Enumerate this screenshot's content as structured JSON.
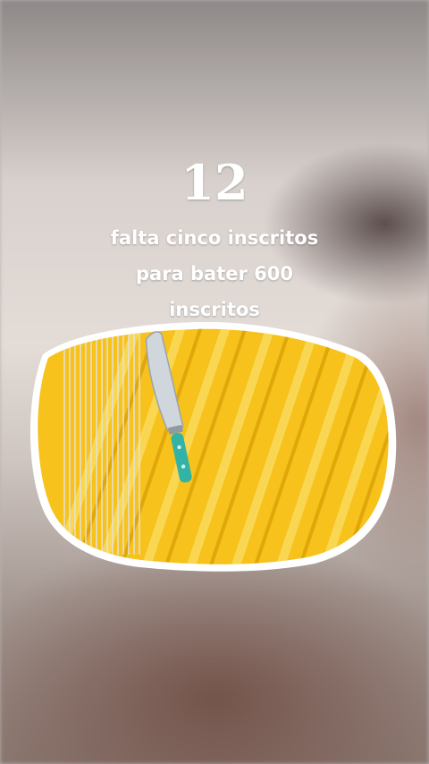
{
  "overlay": {
    "countdown": "12",
    "caption_lines": [
      "falta cinco inscritos",
      "para bater 600",
      "inscritos"
    ]
  },
  "sticker": {
    "name": "pineapple-slice",
    "icon": "knife-icon",
    "colors": {
      "fruit": "#f7c21b",
      "highlight": "#ffe27a",
      "blade": "#cfd6dc",
      "handle": "#33b3a6"
    }
  }
}
